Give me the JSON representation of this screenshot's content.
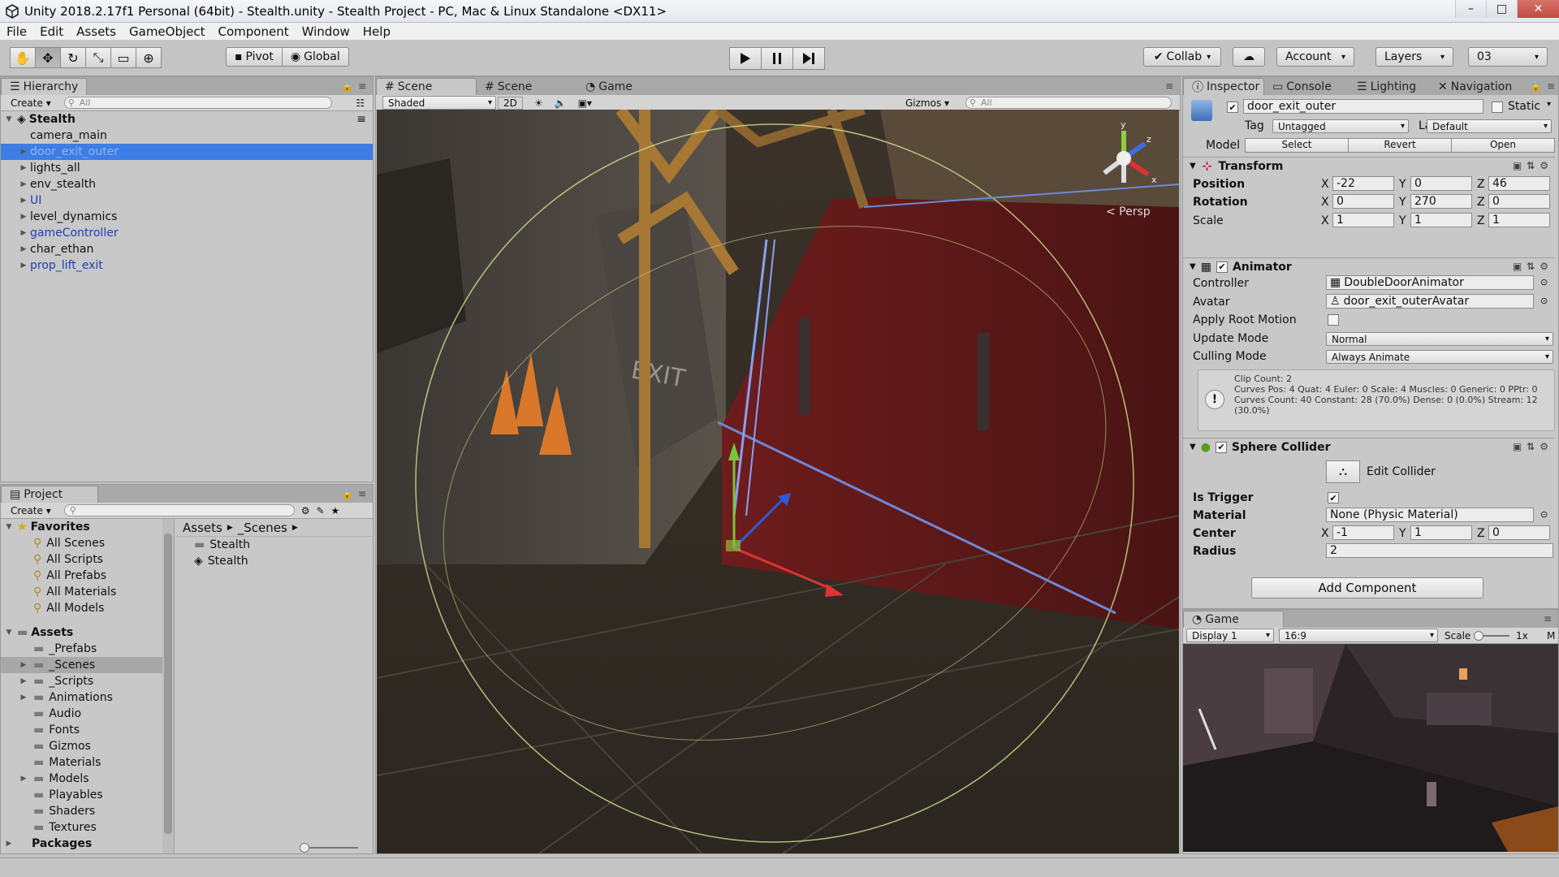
{
  "window": {
    "title": "Unity 2018.2.17f1 Personal (64bit) - Stealth.unity - Stealth Project - PC, Mac & Linux Standalone <DX11>",
    "minimize": "–",
    "maximize": "□",
    "close": "✕"
  },
  "menu": [
    "File",
    "Edit",
    "Assets",
    "GameObject",
    "Component",
    "Window",
    "Help"
  ],
  "toolbar": {
    "pivot": "Pivot",
    "global": "Global",
    "collab": "Collab",
    "account": "Account",
    "layers": "Layers",
    "layout": "03"
  },
  "hierarchy": {
    "tab": "Hierarchy",
    "create": "Create",
    "search_placeholder": "All",
    "scene_name": "Stealth",
    "items": [
      {
        "label": "camera_main",
        "arrow": "",
        "blue": false
      },
      {
        "label": "door_exit_outer",
        "arrow": "▶",
        "blue": true,
        "selected": true
      },
      {
        "label": "lights_all",
        "arrow": "▶",
        "blue": false
      },
      {
        "label": "env_stealth",
        "arrow": "▶",
        "blue": false
      },
      {
        "label": "UI",
        "arrow": "▶",
        "blue": true
      },
      {
        "label": "level_dynamics",
        "arrow": "▶",
        "blue": false
      },
      {
        "label": "gameController",
        "arrow": "▶",
        "blue": true
      },
      {
        "label": "char_ethan",
        "arrow": "▶",
        "blue": false
      },
      {
        "label": "prop_lift_exit",
        "arrow": "▶",
        "blue": true
      }
    ]
  },
  "project": {
    "tab": "Project",
    "create": "Create",
    "favorites_label": "Favorites",
    "favorites": [
      "All Scenes",
      "All Scripts",
      "All Prefabs",
      "All Materials",
      "All Models"
    ],
    "assets_label": "Assets",
    "folders": [
      "_Prefabs",
      "_Scenes",
      "_Scripts",
      "Animations",
      "Audio",
      "Fonts",
      "Gizmos",
      "Materials",
      "Models",
      "Playables",
      "Shaders",
      "Textures"
    ],
    "packages_label": "Packages",
    "breadcrumb_root": "Assets",
    "breadcrumb_current": "_Scenes",
    "files": [
      {
        "label": "Stealth",
        "icon": "folder"
      },
      {
        "label": "Stealth",
        "icon": "unity-scene"
      }
    ]
  },
  "scene": {
    "tabs": [
      "Scene",
      "Scene",
      "Game"
    ],
    "shading": "Shaded",
    "mode_2d": "2D",
    "gizmos": "Gizmos",
    "search_placeholder": "All",
    "persp_label": "< Persp",
    "exit_sign": "EXIT",
    "gizmo_axes": {
      "y": "y",
      "z": "z",
      "x": "x"
    }
  },
  "inspector": {
    "tabs": [
      "Inspector",
      "Console",
      "Lighting",
      "Navigation"
    ],
    "object_name": "door_exit_outer",
    "static_label": "Static",
    "tag_label": "Tag",
    "tag_value": "Untagged",
    "layer_label": "Layer",
    "layer_value": "Default",
    "model_label": "Model",
    "model_buttons": [
      "Select",
      "Revert",
      "Open"
    ],
    "transform": {
      "title": "Transform",
      "position_label": "Position",
      "position": [
        "-22",
        "0",
        "46"
      ],
      "rotation_label": "Rotation",
      "rotation": [
        "0",
        "270",
        "0"
      ],
      "scale_label": "Scale",
      "scale": [
        "1",
        "1",
        "1"
      ]
    },
    "animator": {
      "title": "Animator",
      "controller_label": "Controller",
      "controller": "DoubleDoorAnimator",
      "avatar_label": "Avatar",
      "avatar": "door_exit_outerAvatar",
      "root_motion_label": "Apply Root Motion",
      "update_mode_label": "Update Mode",
      "update_mode": "Normal",
      "culling_mode_label": "Culling Mode",
      "culling_mode": "Always Animate",
      "info_line1": "Clip Count: 2",
      "info_line2": "Curves Pos: 4 Quat: 4 Euler: 0 Scale: 4 Muscles: 0 Generic: 0 PPtr: 0",
      "info_line3": "Curves Count: 40 Constant: 28 (70.0%) Dense: 0 (0.0%) Stream: 12 (30.0%)"
    },
    "sphere_collider": {
      "title": "Sphere Collider",
      "edit_collider": "Edit Collider",
      "is_trigger_label": "Is Trigger",
      "material_label": "Material",
      "material": "None (Physic Material)",
      "center_label": "Center",
      "center": [
        "-1",
        "1",
        "0"
      ],
      "radius_label": "Radius",
      "radius": "2"
    },
    "add_component": "Add Component"
  },
  "game": {
    "tab": "Game",
    "display": "Display 1",
    "aspect": "16:9",
    "scale_label": "Scale",
    "scale_value": "1x",
    "maximize_label": "M"
  },
  "axis_labels": {
    "x": "X",
    "y": "Y",
    "z": "Z"
  }
}
